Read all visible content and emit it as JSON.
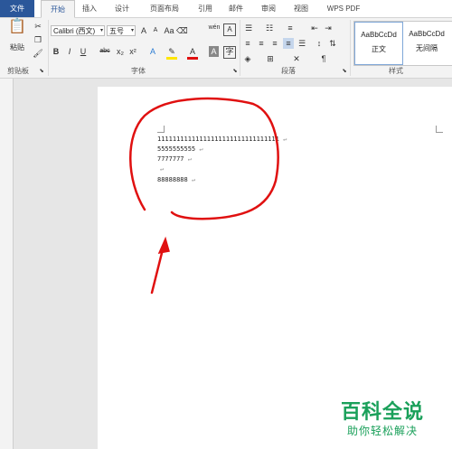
{
  "tabs": {
    "file": "文件",
    "home": "开始",
    "insert": "插入",
    "design": "设计",
    "layout": "页面布局",
    "references": "引用",
    "mailings": "邮件",
    "review": "审阅",
    "view": "视图",
    "wps": "WPS PDF"
  },
  "clipboard": {
    "paste_label": "粘贴",
    "group_label": "剪贴板"
  },
  "font": {
    "name": "Calibri (西文)",
    "size": "五号",
    "grow_label": "A",
    "shrink_label": "A",
    "bold": "B",
    "italic": "I",
    "underline": "U",
    "strike": "abc",
    "subscript": "x₂",
    "superscript": "x²",
    "group_label": "字体"
  },
  "paragraph": {
    "group_label": "段落"
  },
  "styles": {
    "items": [
      {
        "preview": "AaBbCcDd",
        "label": "正文"
      },
      {
        "preview": "AaBbCcDd",
        "label": "无间隔"
      }
    ],
    "group_label": "样式"
  },
  "document": {
    "lines": [
      "11111111111111111111111111111111",
      "5555555555",
      "7777777",
      "",
      "88888888"
    ],
    "para_mark": "↵"
  },
  "watermark": {
    "title": "百科全说",
    "subtitle": "助你轻松解决"
  },
  "colors": {
    "accent": "#2b579a",
    "annotation": "#e01010",
    "watermark": "#1aa05a"
  }
}
